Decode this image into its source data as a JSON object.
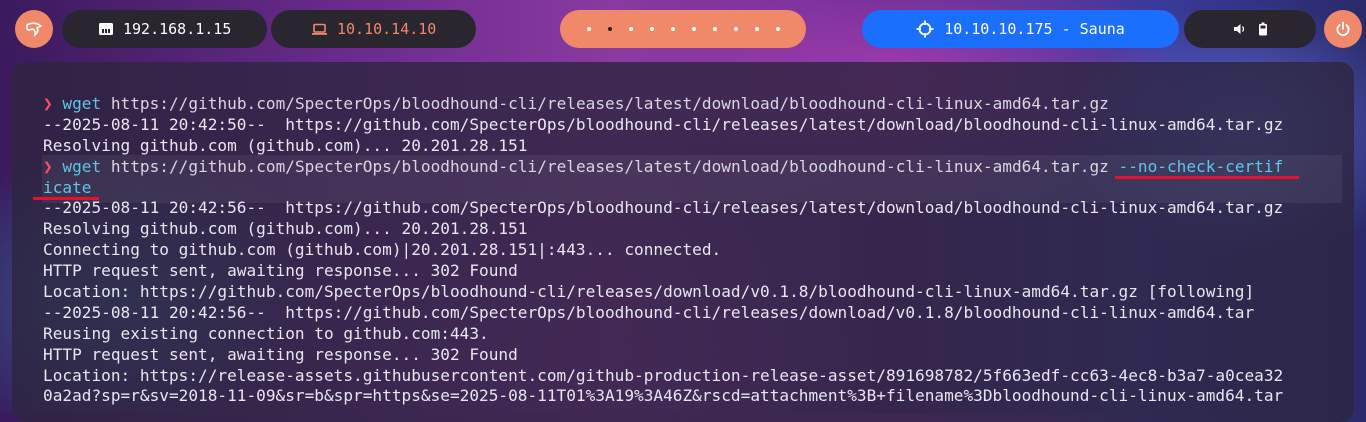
{
  "topbar": {
    "local_ip": "192.168.1.15",
    "vpn_ip": "10.10.14.10",
    "target": "10.10.10.175 - Sauna",
    "workspace_count": 10,
    "active_workspace": 2
  },
  "terminal": {
    "lines": [
      {
        "type": "cmd",
        "prompt": "❯",
        "cmd": "wget",
        "args": " https://github.com/SpecterOps/bloodhound-cli/releases/latest/download/bloodhound-cli-linux-amd64.tar.gz",
        "flag": ""
      },
      {
        "type": "out",
        "text": "--2025-08-11 20:42:50--  https://github.com/SpecterOps/bloodhound-cli/releases/latest/download/bloodhound-cli-linux-amd64.tar.gz"
      },
      {
        "type": "out",
        "text": "Resolving github.com (github.com)... 20.201.28.151"
      },
      {
        "type": "cmd",
        "prompt": "❯",
        "cmd": "wget",
        "args": " https://github.com/SpecterOps/bloodhound-cli/releases/latest/download/bloodhound-cli-linux-amd64.tar.gz ",
        "flag": "--no-check-certif"
      },
      {
        "type": "flagcont",
        "text": "icate"
      },
      {
        "type": "out",
        "text": "--2025-08-11 20:42:56--  https://github.com/SpecterOps/bloodhound-cli/releases/latest/download/bloodhound-cli-linux-amd64.tar.gz"
      },
      {
        "type": "out",
        "text": "Resolving github.com (github.com)... 20.201.28.151"
      },
      {
        "type": "out",
        "text": "Connecting to github.com (github.com)|20.201.28.151|:443... connected."
      },
      {
        "type": "out",
        "text": "HTTP request sent, awaiting response... 302 Found"
      },
      {
        "type": "out",
        "text": "Location: https://github.com/SpecterOps/bloodhound-cli/releases/download/v0.1.8/bloodhound-cli-linux-amd64.tar.gz [following]"
      },
      {
        "type": "out",
        "text": "--2025-08-11 20:42:56--  https://github.com/SpecterOps/bloodhound-cli/releases/download/v0.1.8/bloodhound-cli-linux-amd64.tar"
      },
      {
        "type": "out",
        "text": "Reusing existing connection to github.com:443."
      },
      {
        "type": "out",
        "text": "HTTP request sent, awaiting response... 302 Found"
      },
      {
        "type": "out",
        "text": "Location: https://release-assets.githubusercontent.com/github-production-release-asset/891698782/5f663edf-cc63-4ec8-b3a7-a0cea32"
      },
      {
        "type": "out",
        "text": "0a2ad?sp=r&sv=2018-11-09&sr=b&spr=https&se=2025-08-11T01%3A19%3A46Z&rscd=attachment%3B+filename%3Dbloodhound-cli-linux-amd64.tar"
      }
    ]
  }
}
